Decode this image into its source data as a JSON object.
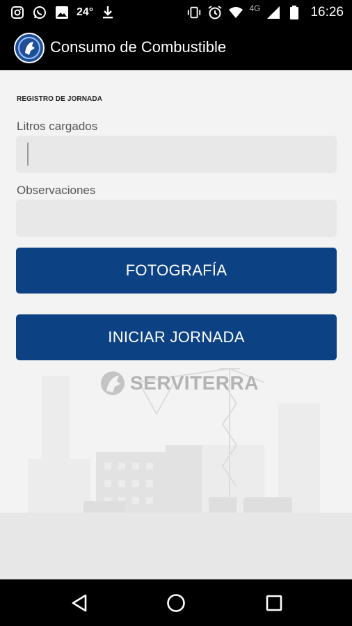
{
  "status_bar": {
    "temperature": "24°",
    "network": "4G",
    "time": "16:26"
  },
  "app_bar": {
    "title": "Consumo de Combustible"
  },
  "form": {
    "section_title": "REGISTRO DE JORNADA",
    "liters_label": "Litros cargados",
    "liters_value": "",
    "observations_label": "Observaciones",
    "observations_value": ""
  },
  "buttons": {
    "photo": "FOTOGRAFÍA",
    "start_shift": "INICIAR JORNADA"
  },
  "branding": {
    "name": "SERVITERRA"
  },
  "colors": {
    "primary": "#0c4283",
    "field_bg": "#e8e8e8",
    "bar_bg": "#000000"
  }
}
